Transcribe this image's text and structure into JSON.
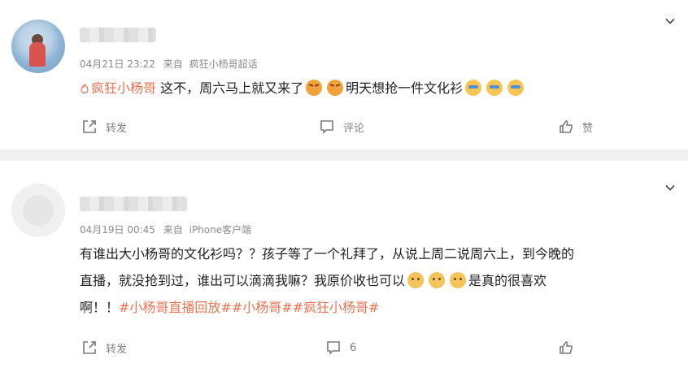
{
  "posts": [
    {
      "timestamp": "04月21日 23:22",
      "source_prefix": "来自",
      "source": "疯狂小杨哥超话",
      "content": {
        "tag": "疯狂小杨哥",
        "text1": " 这不，周六马上就又来了",
        "text2": "明天想抢一件文化衫"
      },
      "actions": {
        "repost": "转发",
        "comment": "评论",
        "like": "赞"
      }
    },
    {
      "timestamp": "04月19日 00:45",
      "source_prefix": "来自",
      "source": "iPhone客户端",
      "content": {
        "line1": "有谁出大小杨哥的文化衫吗？？孩子等了一个礼拜了，从说上周二说周六上，到今晚的",
        "line2_a": "直播，就没抢到过，谁出可以滴滴我嘛？我原价收也可以",
        "line2_b": "是真的很喜欢",
        "line3_a": "啊！！",
        "line3_tags": "#小杨哥直播回放##小杨哥##疯狂小杨哥#"
      },
      "actions": {
        "repost": "转发",
        "comment": "6",
        "like": ""
      }
    }
  ],
  "colors": {
    "tag": "#eb7350",
    "meta": "#8a8a8a",
    "page_bg": "#f1f1f1"
  }
}
